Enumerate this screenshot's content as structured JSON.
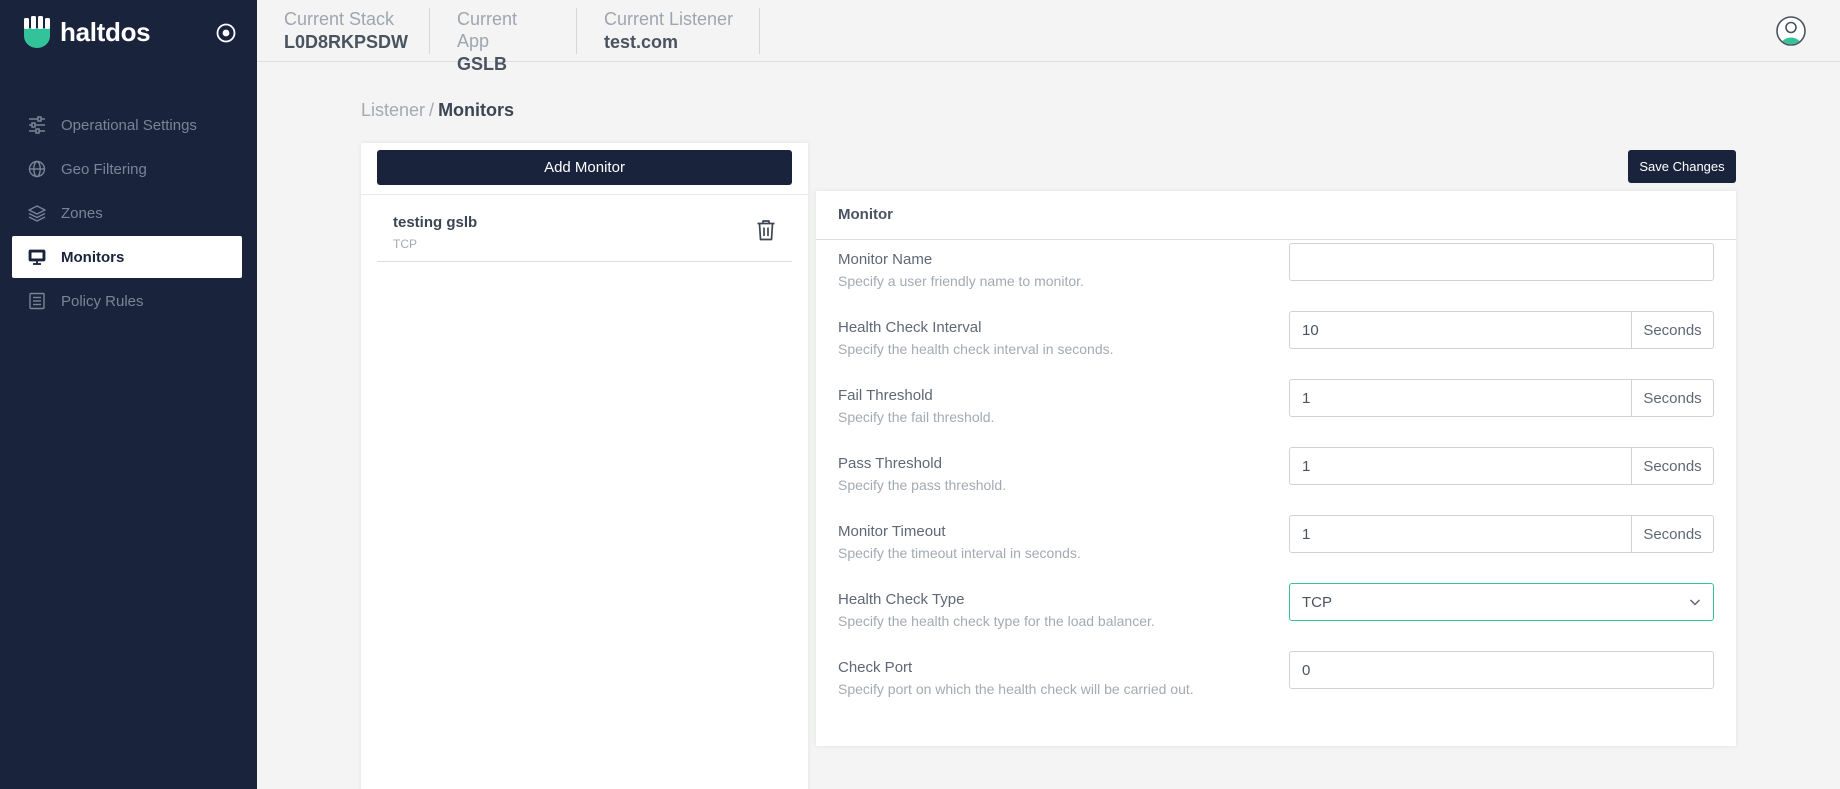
{
  "app": {
    "brand": "haltdos"
  },
  "sidebar": {
    "items": [
      {
        "label": "Operational Settings",
        "icon": "sliders-icon",
        "active": false
      },
      {
        "label": "Geo Filtering",
        "icon": "globe-icon",
        "active": false
      },
      {
        "label": "Zones",
        "icon": "layers-icon",
        "active": false
      },
      {
        "label": "Monitors",
        "icon": "monitor-icon",
        "active": true
      },
      {
        "label": "Policy Rules",
        "icon": "list-icon",
        "active": false
      }
    ]
  },
  "header": {
    "stack": {
      "label": "Current Stack",
      "value": "L0D8RKPSDW"
    },
    "app": {
      "label": "Current App",
      "value": "GSLB"
    },
    "listener": {
      "label": "Current Listener",
      "value": "test.com"
    }
  },
  "breadcrumb": {
    "parent": "Listener",
    "separator": "/",
    "current": "Monitors"
  },
  "list": {
    "add_label": "Add Monitor",
    "items": [
      {
        "name": "testing gslb",
        "type": "TCP"
      }
    ]
  },
  "toolbar": {
    "save_label": "Save Changes"
  },
  "form": {
    "title": "Monitor",
    "monitor_name": {
      "label": "Monitor Name",
      "help": "Specify a user friendly name to monitor.",
      "value": ""
    },
    "health_interval": {
      "label": "Health Check Interval",
      "help": "Specify the health check interval in seconds.",
      "value": "10",
      "unit": "Seconds"
    },
    "fail_threshold": {
      "label": "Fail Threshold",
      "help": "Specify the fail threshold.",
      "value": "1",
      "unit": "Seconds"
    },
    "pass_threshold": {
      "label": "Pass Threshold",
      "help": "Specify the pass threshold.",
      "value": "1",
      "unit": "Seconds"
    },
    "monitor_timeout": {
      "label": "Monitor Timeout",
      "help": "Specify the timeout interval in seconds.",
      "value": "1",
      "unit": "Seconds"
    },
    "health_type": {
      "label": "Health Check Type",
      "help": "Specify the health check type for the load balancer.",
      "value": "TCP"
    },
    "check_port": {
      "label": "Check Port",
      "help": "Specify port on which the health check will be carried out.",
      "value": "0"
    }
  },
  "colors": {
    "sidebar_bg": "#19233b",
    "accent": "#33c39a",
    "page_bg": "#f3f4f3"
  }
}
